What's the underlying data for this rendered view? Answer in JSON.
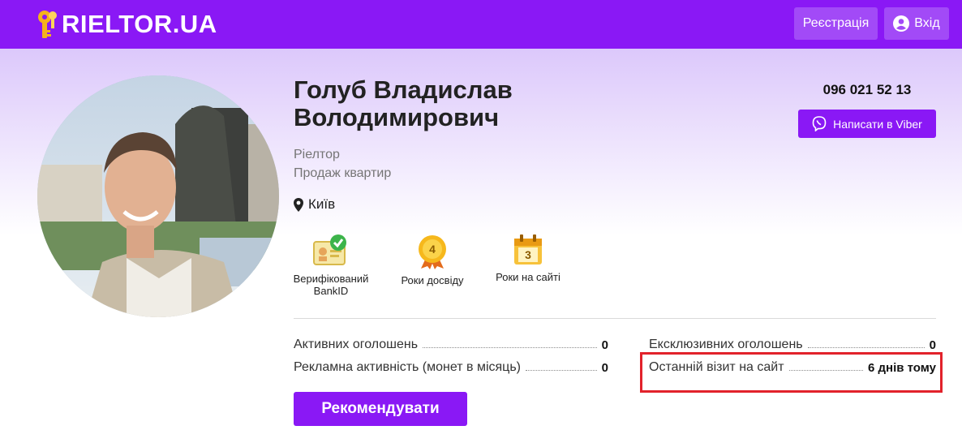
{
  "header": {
    "logo_text": "RIELTOR.UA",
    "register_label": "Реєстрація",
    "login_label": "Вхід"
  },
  "profile": {
    "name": "Голуб Владислав Володимирович",
    "role": "Ріелтор",
    "specialization": "Продаж квартир",
    "city": "Київ",
    "phone": "096 021 52 13",
    "viber_label": "Написати в Viber"
  },
  "badges": [
    {
      "icon": "verified-bankid-icon",
      "label": "Верифікований BankID"
    },
    {
      "icon": "medal-icon",
      "value": "4",
      "label": "Роки досвіду"
    },
    {
      "icon": "calendar-icon",
      "value": "3",
      "label": "Роки на сайті"
    }
  ],
  "stats": {
    "active_listings": {
      "label": "Активних оголошень",
      "value": "0"
    },
    "ad_activity": {
      "label": "Рекламна активність (монет в місяць)",
      "value": "0"
    },
    "exclusive_listings": {
      "label": "Ексклюзивних оголошень",
      "value": "0"
    },
    "last_visit": {
      "label": "Останній візит на сайт",
      "value": "6 днів тому"
    }
  },
  "recommend_label": "Рекомендувати",
  "colors": {
    "brand": "#8a18f5",
    "highlight": "#e2222b",
    "logo_key": "#f5b21c"
  }
}
